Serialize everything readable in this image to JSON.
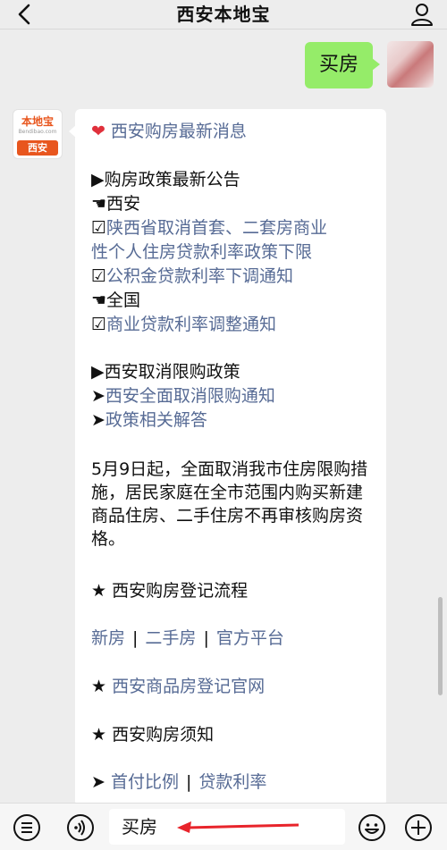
{
  "header": {
    "title": "西安本地宝",
    "back_icon": "chevron-left-icon",
    "profile_icon": "person-icon"
  },
  "chat": {
    "outgoing_message": "买房",
    "bot_avatar": {
      "logo_text": "本地宝",
      "logo_sub": "Bendibao.com",
      "city": "西安"
    },
    "reply": {
      "title": "西安购房最新消息",
      "section1_heading": "▶购房政策最新公告",
      "xian_label": "西安",
      "xian_link1_line1": "陕西省取消首套、二套房商业",
      "xian_link1_line2": "性个人住房贷款利率政策下限",
      "xian_link2": "公积金贷款利率下调通知",
      "national_label": "全国",
      "national_link": "商业贷款利率调整通知",
      "section2_heading": "▶西安取消限购政策",
      "section2_link1": "西安全面取消限购通知",
      "section2_link2": "政策相关解答",
      "paragraph": "5月9日起，全面取消我市住房限购措施，居民家庭在全市范围内购买新建商品住房、二手住房不再审核购房资格。",
      "section3_heading": "西安购房登记流程",
      "section3_links": [
        "新房",
        "二手房",
        "官方平台"
      ],
      "section4_heading": "西安商品房登记官网",
      "section5_heading": "西安购房须知",
      "section5_links": [
        "首付比例",
        "贷款利率"
      ]
    }
  },
  "input_bar": {
    "text": "买房",
    "menu_icon": "list-icon",
    "voice_icon": "voice-icon",
    "emoji_icon": "emoji-icon",
    "plus_icon": "plus-icon"
  },
  "colors": {
    "link": "#576b95",
    "outgoing_bubble": "#95ec69",
    "logo_orange": "#e8561e",
    "arrow_red": "#e8242b"
  }
}
